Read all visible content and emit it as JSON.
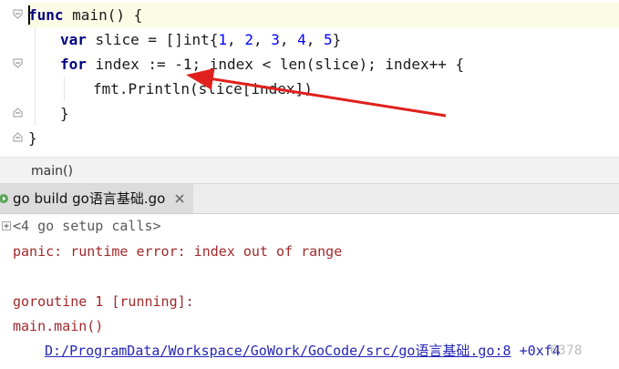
{
  "editor": {
    "lines": [
      {
        "kw": "func",
        "rest": " main() {"
      },
      {
        "kw": "var",
        "rest": " slice = []int{",
        "nums": [
          "1",
          "2",
          "3",
          "4",
          "5"
        ],
        "tail": "}"
      },
      {
        "kw": "for",
        "rest": " index := -1; index < len(slice); index++ {"
      },
      {
        "text": "fmt.Println(slice[index])"
      },
      {
        "text": "}"
      },
      {
        "text": "}"
      }
    ]
  },
  "breadcrumb": {
    "label": "main()"
  },
  "run_tab": {
    "label": "go build go语言基础.go",
    "close_icon": "close-icon",
    "run_icon": "run-icon"
  },
  "console": {
    "setup_calls": "<4 go setup calls>",
    "panic": "panic: runtime error: index out of range",
    "goroutine": "goroutine 1 [running]:",
    "frame": "main.main()",
    "path_link": "D:/ProgramData/Workspace/GoWork/GoCode/src/go语言基础.go:8",
    "offset": " +0xf4"
  },
  "watermark": {
    "text": "6378"
  },
  "colors": {
    "arrow": "#e0201c",
    "keyword": "#000080",
    "number": "#0000ff",
    "error": "#a1292b",
    "link": "#2626b8"
  }
}
